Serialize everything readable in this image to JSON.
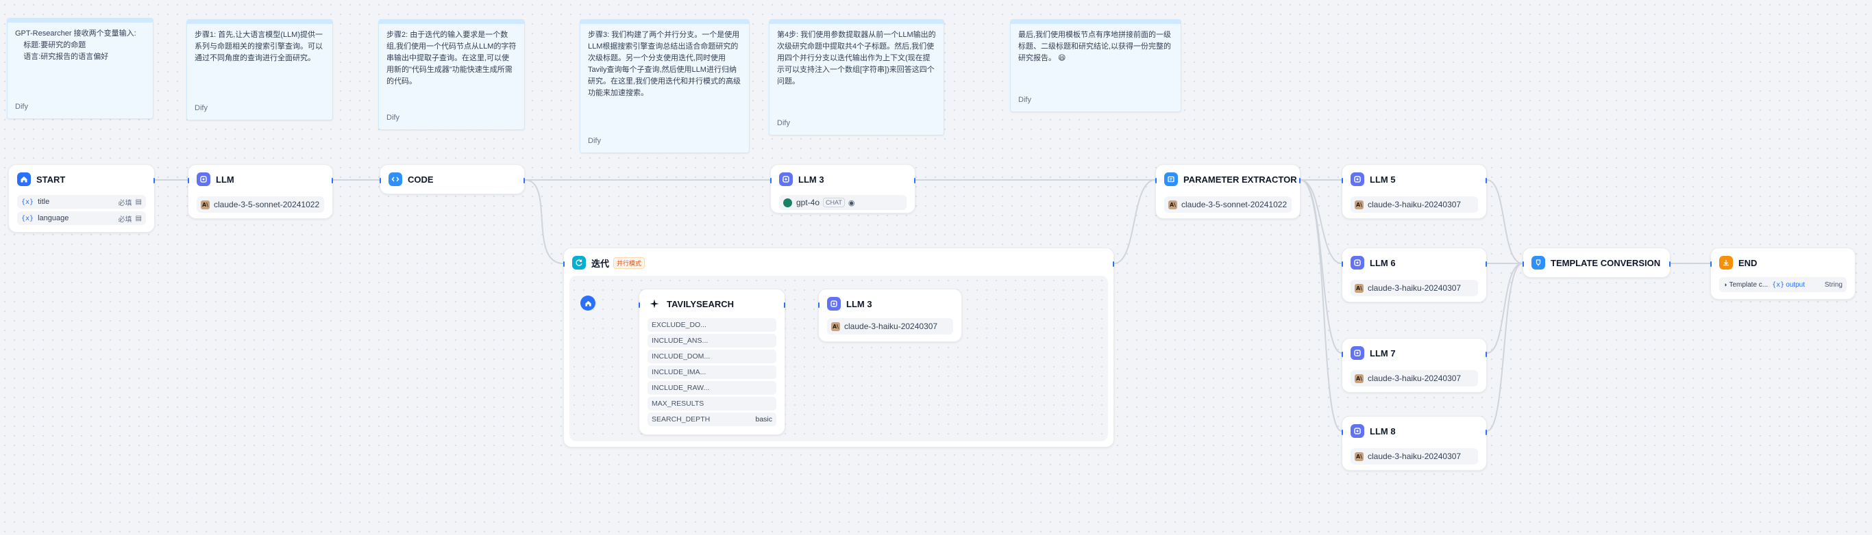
{
  "notes": [
    {
      "text": "GPT-Researcher 接收两个变量输入:\n    标题:要研究的命题\n    语言:研究报告的语言偏好",
      "author": "Dify"
    },
    {
      "text": "步骤1: 首先,让大语言模型(LLM)提供一系列与命题相关的搜索引擎查询。可以通过不同角度的查询进行全面研究。",
      "author": "Dify"
    },
    {
      "text": "步骤2: 由于迭代的输入要求是一个数组,我们使用一个代码节点从LLM的字符串输出中提取子查询。在这里,可以使用新的\"代码生成器\"功能快速生成所需的代码。",
      "author": "Dify"
    },
    {
      "text": "步骤3: 我们构建了两个并行分支。一个是使用LLM根据搜索引擎查询总结出适合命题研究的次级标题。另一个分支使用迭代,同时使用Tavily查询每个子查询,然后使用LLM进行归纳研究。在这里,我们使用迭代和并行模式的高级功能来加速搜索。",
      "author": "Dify"
    },
    {
      "text": "第4步: 我们使用参数提取器从前一个LLM输出的次级研究命题中提取共4个子标题。然后,我们使用四个并行分支以迭代输出作为上下文(现在提示可以支持注入一个数组[字符串])来回答这四个问题。",
      "author": "Dify"
    },
    {
      "text": "最后,我们使用模板节点有序地拼接前面的一级标题、二级标题和研究结论,以获得一份完整的研究报告。 😄",
      "author": "Dify"
    }
  ],
  "nodes": {
    "start": {
      "title": "START",
      "variables": [
        {
          "icon": "{x}",
          "name": "title",
          "required": "必填"
        },
        {
          "icon": "{x}",
          "name": "language",
          "required": "必填"
        }
      ]
    },
    "llm": {
      "title": "LLM",
      "model": "claude-3-5-sonnet-20241022"
    },
    "code": {
      "title": "CODE"
    },
    "llm3_top": {
      "title": "LLM 3",
      "model": "gpt-4o",
      "mode": "CHAT"
    },
    "iteration": {
      "title": "迭代",
      "badge": "并行模式"
    },
    "tavily": {
      "title": "TAVILYSEARCH",
      "params": [
        {
          "name": "EXCLUDE_DO...",
          "value": ""
        },
        {
          "name": "INCLUDE_ANS...",
          "value": ""
        },
        {
          "name": "INCLUDE_DOM...",
          "value": ""
        },
        {
          "name": "INCLUDE_IMA...",
          "value": ""
        },
        {
          "name": "INCLUDE_RAW...",
          "value": ""
        },
        {
          "name": "MAX_RESULTS",
          "value": ""
        },
        {
          "name": "SEARCH_DEPTH",
          "value": "basic"
        }
      ]
    },
    "llm3_inner": {
      "title": "LLM 3",
      "model": "claude-3-haiku-20240307"
    },
    "param_extractor": {
      "title": "PARAMETER EXTRACTOR",
      "model": "claude-3-5-sonnet-20241022"
    },
    "llm5": {
      "title": "LLM 5",
      "model": "claude-3-haiku-20240307"
    },
    "llm6": {
      "title": "LLM 6",
      "model": "claude-3-haiku-20240307"
    },
    "llm7": {
      "title": "LLM 7",
      "model": "claude-3-haiku-20240307"
    },
    "llm8": {
      "title": "LLM 8",
      "model": "claude-3-haiku-20240307"
    },
    "template": {
      "title": "TEMPLATE CONVERSION"
    },
    "end": {
      "title": "END",
      "source": "Template c...",
      "var": "output",
      "type": "String"
    }
  },
  "colors": {
    "accent": "#2970ff",
    "edge": "#d0d5dd",
    "note_bg": "#eff8ff"
  },
  "icons": {
    "start": "home-icon",
    "llm": "llm-icon",
    "code": "code-icon",
    "iteration": "iteration-icon",
    "tavily": "sparkle-icon",
    "param_extractor": "extractor-icon",
    "template": "template-icon",
    "end": "end-icon"
  }
}
